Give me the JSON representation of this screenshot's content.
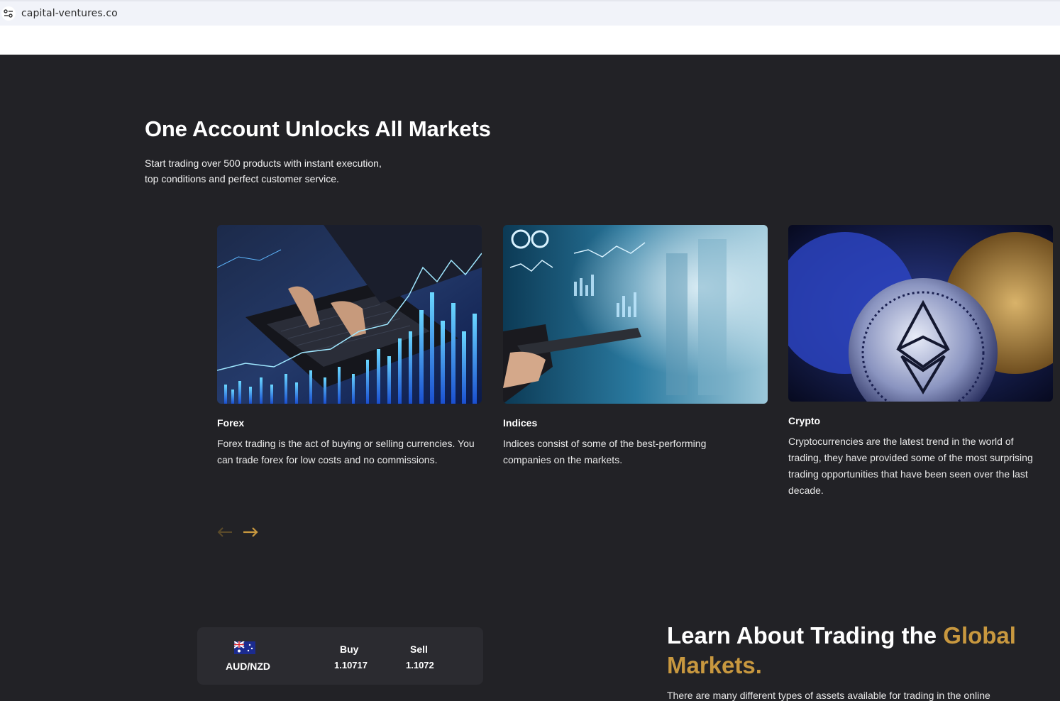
{
  "browser": {
    "url": "capital-ventures.co"
  },
  "hero": {
    "title": "One Account Unlocks All Markets",
    "subtitle_line1": "Start trading over 500 products with instant execution,",
    "subtitle_line2": "top conditions and perfect customer service."
  },
  "markets": [
    {
      "title": "Forex",
      "image": "forex-trading-image",
      "desc_line1": "Forex trading is the act of buying or selling currencies. You",
      "desc_line2": "can trade forex for low costs and no commissions."
    },
    {
      "title": "Indices",
      "image": "indices-dashboard-image",
      "desc_line1": "Indices consist of some of the best-performing",
      "desc_line2": "companies on the markets."
    },
    {
      "title": "Crypto",
      "image": "crypto-coins-image",
      "desc_line1": "Cryptocurrencies are the latest trend in the world of",
      "desc_line2": "trading, they have provided some of the most surprising",
      "desc_line3": "trading opportunities that have been seen over the last",
      "desc_line4": "decade."
    }
  ],
  "carousel": {
    "prev_icon": "arrow-left-icon",
    "next_icon": "arrow-right-icon"
  },
  "ticker": {
    "flag_icon": "australia-flag-icon",
    "pair": "AUD/NZD",
    "buy_label": "Buy",
    "buy_value": "1.10717",
    "sell_label": "Sell",
    "sell_value": "1.1072"
  },
  "learn": {
    "title_part1": "Learn About Trading the ",
    "title_highlight1": "Global",
    "title_highlight2": "Markets.",
    "text": "There are many different types of assets available for trading in the online"
  },
  "colors": {
    "background": "#222226",
    "accent": "#c8983f",
    "panel": "#2b2b30"
  }
}
